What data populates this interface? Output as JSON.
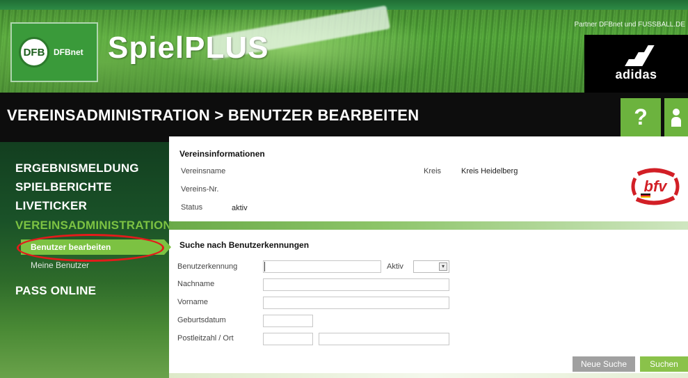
{
  "header": {
    "logo_text": "DFBnet",
    "app_title": "SpielPLUS",
    "partner_text": "Partner DFBnet und FUSSBALL.DE",
    "sponsor": "adidas"
  },
  "titlebar": {
    "heading": "VEREINSADMINISTRATION > BENUTZER BEARBEITEN",
    "help_label": "?"
  },
  "sidebar": {
    "items": [
      {
        "label": "ERGEBNISMELDUNG"
      },
      {
        "label": "SPIELBERICHTE"
      },
      {
        "label": "LIVETICKER"
      },
      {
        "label": "VEREINSADMINISTRATION"
      },
      {
        "label": "PASS ONLINE"
      }
    ],
    "sub_items": [
      {
        "label": "Benutzer bearbeiten"
      },
      {
        "label": "Meine Benutzer"
      }
    ]
  },
  "vereinsinfo": {
    "title": "Vereinsinformationen",
    "vereinsname_label": "Vereinsname",
    "vereinsnr_label": "Vereins-Nr.",
    "status_label": "Status",
    "status_value": "aktiv",
    "kreis_label": "Kreis",
    "kreis_value": "Kreis Heidelberg",
    "logo_text": "bfv"
  },
  "search": {
    "title": "Suche nach Benutzerkennungen",
    "benutzerkennung_label": "Benutzerkennung",
    "aktiv_label": "Aktiv",
    "nachname_label": "Nachname",
    "vorname_label": "Vorname",
    "geburtsdatum_label": "Geburtsdatum",
    "plz_ort_label": "Postleitzahl / Ort",
    "new_search_button": "Neue Suche",
    "search_button": "Suchen"
  },
  "colors": {
    "accent_green": "#7cc242",
    "highlight_red": "#e31b1b",
    "titlebar_black": "#0d0d0d"
  }
}
